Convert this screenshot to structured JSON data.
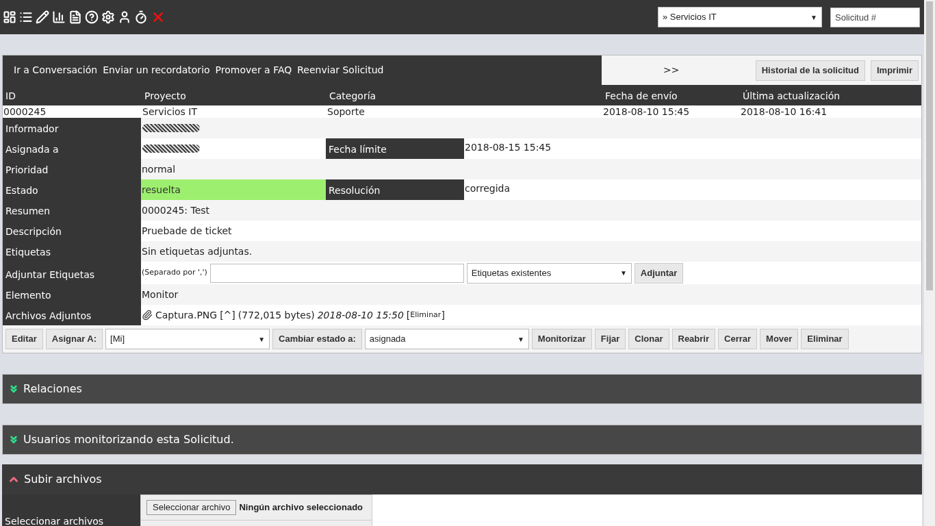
{
  "dropdown_arrow": "▼",
  "top_bar": {
    "project_select": "» Servicios IT",
    "search": {
      "placeholder": "Solicitud #"
    }
  },
  "action_links": [
    "Ir a Conversación",
    "Enviar un recordatorio",
    "Promover a FAQ",
    "Reenviar Solicitud"
  ],
  "nav_link": ">>",
  "header_buttons": [
    "Historial de la solicitud",
    "Imprimir"
  ],
  "summary": {
    "columns": [
      "ID",
      "Proyecto",
      "Categoría",
      "Fecha de envío",
      "Última actualización"
    ],
    "values": [
      "0000245",
      "Servicios IT",
      "Soporte",
      "2018-08-10 15:45",
      "2018-08-10 16:41"
    ]
  },
  "fields": [
    {
      "kind": "redacted",
      "label": "Informador"
    },
    {
      "kind": "redacted",
      "label": "Asignada a",
      "extra_label": "Fecha límite",
      "extra_value": "2018-08-15 15:45"
    },
    {
      "kind": "text",
      "label": "Prioridad",
      "value": "normal"
    },
    {
      "kind": "text",
      "label": "Estado",
      "value": "resuelta",
      "color": "#9df06f",
      "extra_label": "Resolución",
      "extra_value": "corregida"
    },
    {
      "kind": "text",
      "label": "Resumen",
      "value": "0000245: Test"
    },
    {
      "kind": "text",
      "label": "Descripción",
      "value": "Pruebade de ticket"
    },
    {
      "kind": "text",
      "label": "Etiquetas",
      "value": "Sin etiquetas adjuntas."
    },
    {
      "kind": "tags",
      "label": "Adjuntar Etiquetas",
      "hint": "(Separado por ',')",
      "select": "Etiquetas existentes",
      "button": "Adjuntar"
    },
    {
      "kind": "text",
      "label": "Elemento",
      "value": "Monitor"
    },
    {
      "kind": "attachment",
      "label": "Archivos Adjuntos",
      "file": "Captura.PNG",
      "link": "[^]",
      "size": "(772,015 bytes)",
      "date": "2018-08-10 15:50",
      "delete_open": "[",
      "delete": "Eliminar",
      "delete_close": "]"
    }
  ],
  "actions": [
    {
      "kind": "button",
      "label": "Editar"
    },
    {
      "kind": "button",
      "label": "Asignar A:"
    },
    {
      "kind": "select",
      "label": "[Mi]"
    },
    {
      "kind": "button",
      "label": "Cambiar estado a:"
    },
    {
      "kind": "select",
      "label": "asignada"
    },
    {
      "kind": "button",
      "label": "Monitorizar"
    },
    {
      "kind": "button",
      "label": "Fijar"
    },
    {
      "kind": "button",
      "label": "Clonar"
    },
    {
      "kind": "button",
      "label": "Reabrir"
    },
    {
      "kind": "button",
      "label": "Cerrar"
    },
    {
      "kind": "button",
      "label": "Mover"
    },
    {
      "kind": "button",
      "label": "Eliminar"
    }
  ],
  "sections": [
    {
      "title": "Relaciones",
      "expanded": false
    },
    {
      "title": "Usuarios monitorizando esta Solicitud.",
      "expanded": false
    },
    {
      "title": "Subir archivos",
      "expanded": true
    }
  ],
  "upload": {
    "label": "Seleccionar archivos",
    "button": "Seleccionar archivo",
    "status": "Ningún archivo seleccionado"
  }
}
